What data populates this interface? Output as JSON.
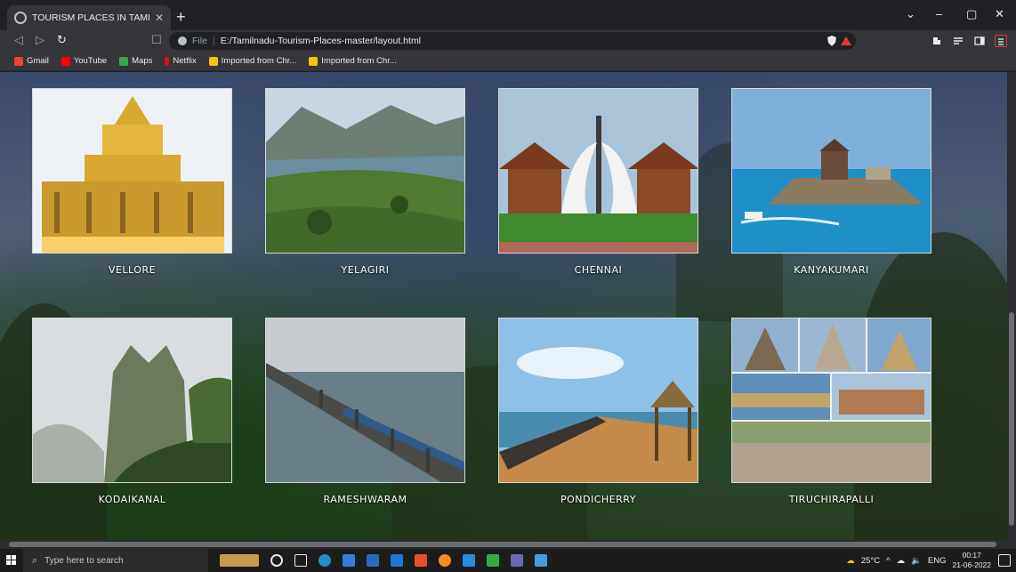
{
  "tab": {
    "title": "TOURISM PLACES IN TAMILNADU"
  },
  "window_controls": {
    "dropdown": "⌄",
    "minimize": "–",
    "maximize": "▢",
    "close": "✕"
  },
  "address": {
    "scheme_label": "File",
    "url": "E:/Tamilnadu-Tourism-Places-master/layout.html"
  },
  "bookmarks": [
    {
      "label": "Gmail",
      "color": "#ea4335"
    },
    {
      "label": "YouTube",
      "color": "#ff0000"
    },
    {
      "label": "Maps",
      "color": "#34a853"
    },
    {
      "label": "Netflix",
      "color": "#e50914"
    },
    {
      "label": "Imported from Chr...",
      "color": "#f4c20d"
    },
    {
      "label": "Imported from Chr...",
      "color": "#f4c20d"
    }
  ],
  "places": [
    {
      "name": "VELLORE",
      "colors": [
        "#f7d06a",
        "#c99a2e",
        "#eef2f6"
      ]
    },
    {
      "name": "YELAGIRI",
      "colors": [
        "#c8d6e2",
        "#6e8b5a",
        "#3f6a2a"
      ]
    },
    {
      "name": "CHENNAI",
      "colors": [
        "#a9c4d8",
        "#f0f0f0",
        "#3e8a2e"
      ]
    },
    {
      "name": "KANYAKUMARI",
      "colors": [
        "#7fb0d9",
        "#1f8fc7",
        "#8a7a60"
      ]
    },
    {
      "name": "KODAIKANAL",
      "colors": [
        "#d9dde0",
        "#6b7a5a",
        "#2f4a22"
      ]
    },
    {
      "name": "RAMESHWARAM",
      "colors": [
        "#c7ccd0",
        "#6a7e88",
        "#3d4c55"
      ]
    },
    {
      "name": "PONDICHERRY",
      "colors": [
        "#8fc1e8",
        "#4a8cb0",
        "#c48a4a"
      ]
    },
    {
      "name": "TIRUCHIRAPALLI",
      "colors": [
        "#8fb0cf",
        "#c4a36a",
        "#7a6a52"
      ]
    }
  ],
  "taskbar": {
    "search_placeholder": "Type here to search",
    "weather": "25°C",
    "language": "ENG",
    "time": "00:17",
    "date": "21-06-2022"
  }
}
